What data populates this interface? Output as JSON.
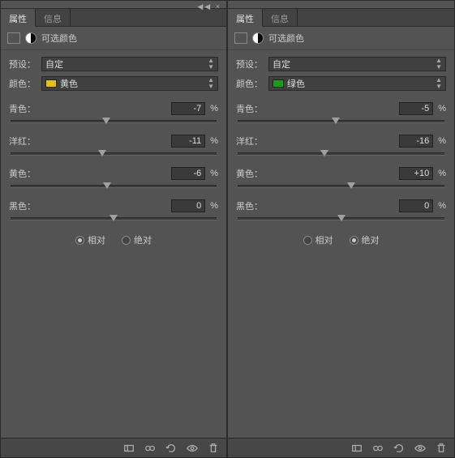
{
  "tabs": {
    "properties": "属性",
    "info": "信息"
  },
  "title": "可选颜色",
  "preset_label": "预设：",
  "color_label": "颜色：",
  "preset_value": "自定",
  "percent": "%",
  "sliders": {
    "cyan": "青色：",
    "magenta": "洋红：",
    "yellow": "黄色：",
    "black": "黑色："
  },
  "mode": {
    "relative": "相对",
    "absolute": "绝对"
  },
  "panels": [
    {
      "color_name": "黄色",
      "swatch": "#e6c200",
      "values": {
        "cyan": -7,
        "magenta": -11,
        "yellow": -6,
        "black": 0
      },
      "mode_selected": "relative"
    },
    {
      "color_name": "绿色",
      "swatch": "#1a9e1a",
      "values": {
        "cyan": -5,
        "magenta": -16,
        "yellow": 10,
        "black": 0
      },
      "mode_selected": "absolute"
    }
  ],
  "chart_data": null
}
